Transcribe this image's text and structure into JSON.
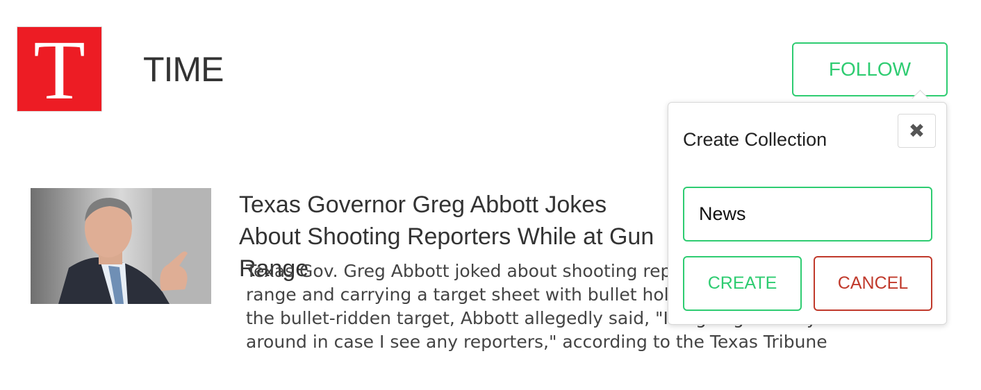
{
  "publisher": {
    "logo_letter": "T",
    "name": "TIME",
    "follow_label": "FOLLOW"
  },
  "article": {
    "title": "Texas Governor Greg Abbott Jokes About Shooting Reporters While at Gun Range",
    "summary": "Texas Gov. Greg Abbott joked about shooting reporters while at a gun range and carrying a target sheet with bullet holes in it. While holding the bullet-ridden target, Abbott allegedly said, \"I'm going to carry this around in case I see any reporters,\" according to the Texas Tribune"
  },
  "popover": {
    "title": "Create Collection",
    "close_icon": "close-icon",
    "input_value": "News",
    "create_label": "CREATE",
    "cancel_label": "CANCEL"
  },
  "colors": {
    "logo_red": "#ed1c24",
    "accent_green": "#2ecc71",
    "danger_red": "#c0392b"
  }
}
